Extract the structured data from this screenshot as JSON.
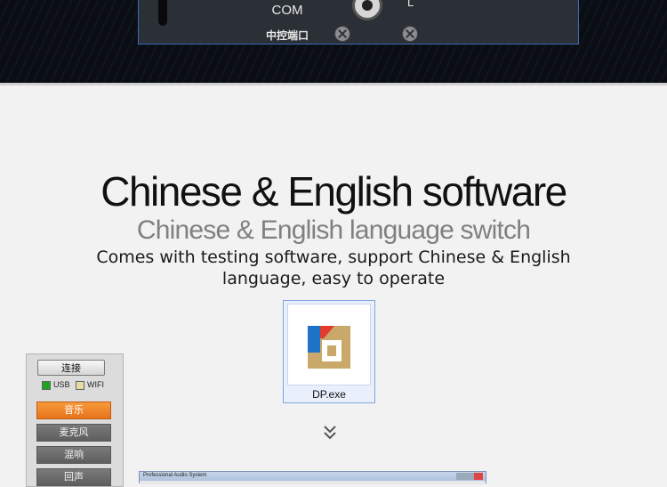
{
  "hardware": {
    "com_label": "COM",
    "port_label_cn": "中控端口",
    "channel_label": "L"
  },
  "heading": {
    "title": "Chinese & English software",
    "subtitle": "Chinese & English language switch",
    "description": "Comes with testing software, support Chinese & English language, easy to operate"
  },
  "desktop_icon": {
    "label": "DP.exe",
    "icon_name": "dp-app-icon"
  },
  "software_panel": {
    "connect_button": "连接",
    "indicators": [
      {
        "label": "USB",
        "color": "#1ea51e"
      },
      {
        "label": "WIFI",
        "color": "#e7dca6"
      }
    ],
    "menu": [
      {
        "label": "音乐",
        "active": true
      },
      {
        "label": "麦克风",
        "active": false
      },
      {
        "label": "混响",
        "active": false
      },
      {
        "label": "回声",
        "active": false
      }
    ],
    "accent_color": "#e7731c"
  },
  "software_window": {
    "title": "Professional Audio System"
  }
}
